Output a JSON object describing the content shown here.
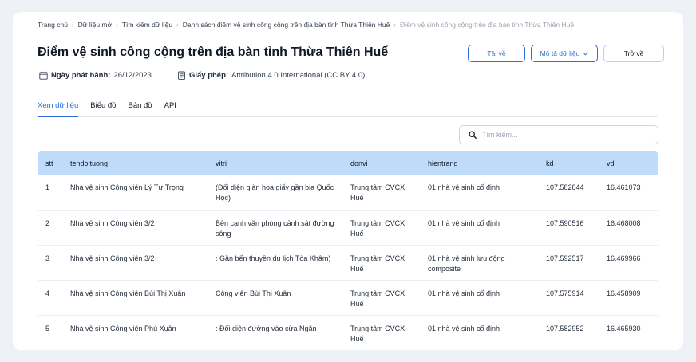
{
  "breadcrumb": {
    "home": "Trang chủ",
    "open_data": "Dữ liệu mở",
    "search": "Tìm kiếm dữ liệu",
    "list": "Danh sách điểm vệ sinh công cộng trên địa bàn tỉnh Thừa Thiên Huế",
    "current": "Điểm vệ sinh công cộng trên địa bàn tỉnh Thừa Thiên Huế"
  },
  "page": {
    "title": "Điểm vệ sinh công cộng trên địa bàn tỉnh Thừa Thiên Huế"
  },
  "actions": {
    "download_label": "Tải về",
    "describe_label": "Mô tả dữ liệu",
    "back_label": "Trở về"
  },
  "meta": {
    "release_label": "Ngày phát hành:",
    "release_date": "26/12/2023",
    "license_label": "Giấy phép:",
    "license_value": "Attribution 4.0 International (CC BY 4.0)"
  },
  "tabs": [
    "Xem dữ liệu",
    "Biểu đồ",
    "Bản đồ",
    "API"
  ],
  "search": {
    "placeholder": "Tìm kiếm..."
  },
  "table": {
    "headers": [
      "stt",
      "tendoituong",
      "vitri",
      "donvi",
      "hientrang",
      "kd",
      "vd"
    ],
    "rows": [
      [
        "1",
        "Nhà vệ sinh Công viên Lý Tự Trọng",
        "(Đối diện giàn hoa giấy gần bia Quốc Học)",
        "Trung tâm CVCX Huế",
        "01 nhà vệ sinh cố định",
        "107.582844",
        "16.461073"
      ],
      [
        "2",
        "Nhà vệ sinh Công viên 3/2",
        "Bên cạnh văn phòng cảnh sát đường sông",
        "Trung tâm CVCX Huế",
        "01 nhà vệ sinh cố định",
        "107.590516",
        "16.468008"
      ],
      [
        "3",
        "Nhà vệ sinh Công viên 3/2",
        ": Gần bến thuyền du lịch Tòa Khâm)",
        "Trung tâm CVCX Huế",
        "01 nhà vệ sinh lưu động composite",
        "107.592517",
        "16.469966"
      ],
      [
        "4",
        "Nhà vệ sinh Công viên Bùi Thị Xuân",
        "Công viên Bùi Thị Xuân",
        "Trung tâm CVCX Huế",
        "01 nhà vệ sinh cố định",
        "107.575914",
        "16.458909"
      ],
      [
        "5",
        "Nhà vệ sinh Công viên Phú Xuân",
        ": Đối diện đường vào cửa Ngăn",
        "Trung tâm CVCX Huế",
        "01 nhà vệ sinh cố định",
        "107.582952",
        "16.465930"
      ]
    ]
  },
  "colors": {
    "accent": "#2b6fd6",
    "header_bg": "#bfdbfa",
    "page_bg": "#eef1f6"
  }
}
